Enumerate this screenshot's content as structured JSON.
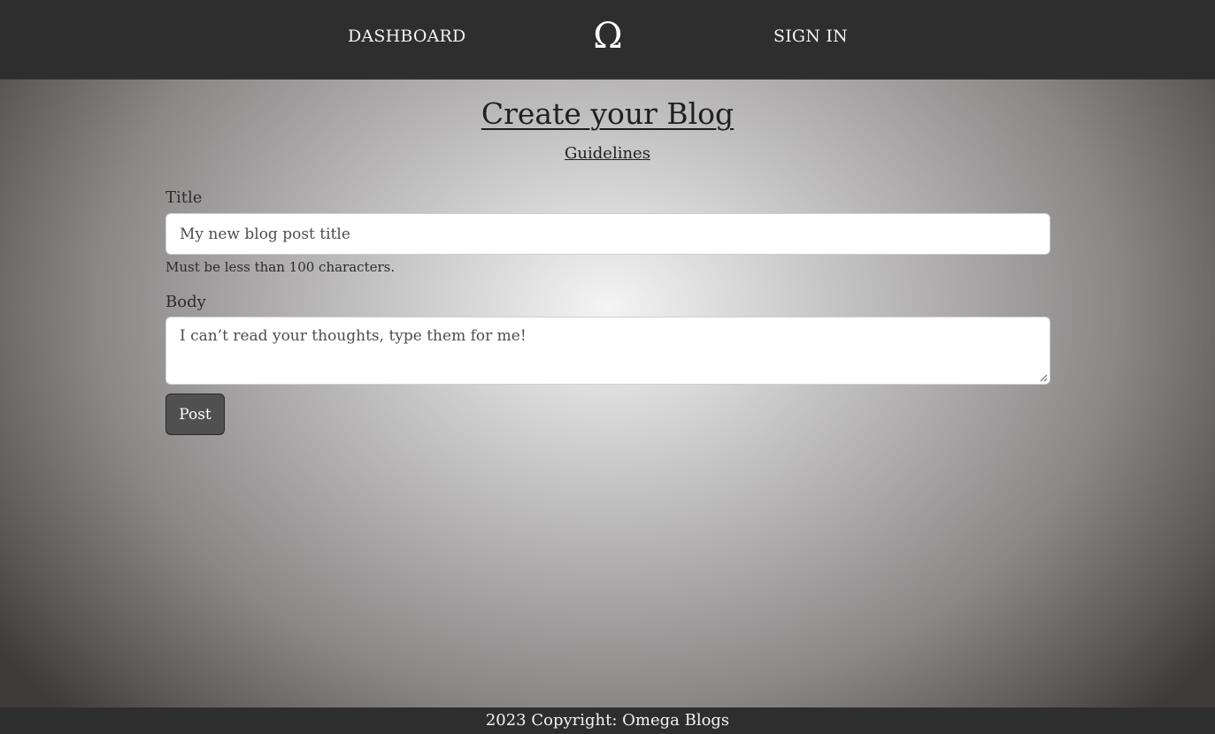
{
  "nav": {
    "dashboard_label": "DASHBOARD",
    "logo_glyph": "Ω",
    "signin_label": "SIGN IN"
  },
  "main": {
    "title": "Create your Blog",
    "guidelines_link": "Guidelines",
    "form": {
      "title_label": "Title",
      "title_placeholder": "My new blog post title",
      "title_value": "",
      "title_hint": "Must be less than 100 characters.",
      "body_label": "Body",
      "body_placeholder": "I can’t read your thoughts, type them for me!",
      "body_value": "",
      "submit_label": "Post"
    }
  },
  "footer": {
    "text": "2023 Copyright: Omega Blogs"
  },
  "colors": {
    "navbar_bg": "#2e2e2e",
    "button_bg": "#505050",
    "text_dark": "#1f1f1f"
  }
}
